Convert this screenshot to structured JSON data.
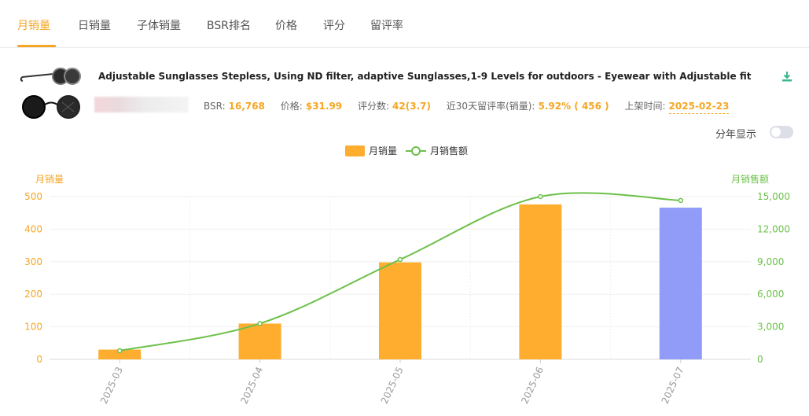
{
  "tabs": [
    {
      "label": "月销量",
      "active": true
    },
    {
      "label": "日销量"
    },
    {
      "label": "子体销量"
    },
    {
      "label": "BSR排名"
    },
    {
      "label": "价格"
    },
    {
      "label": "评分"
    },
    {
      "label": "留评率"
    }
  ],
  "product": {
    "title": "Adjustable Sunglasses Stepless, Using ND filter, adaptive Sunglasses,1-9 Levels for outdoors - Eyewear with Adjustable fit",
    "bsr_label": "BSR:",
    "bsr": "16,768",
    "price_label": "价格:",
    "price": "$31.99",
    "ratings_label": "评分数:",
    "ratings": "42(3.7)",
    "review_rate_label": "近30天留评率(销量):",
    "review_rate": "5.92% ( 456 )",
    "listed_label": "上架时间:",
    "listed_date": "2025-02-23"
  },
  "toggle": {
    "label": "分年显示",
    "on": false
  },
  "colors": {
    "accent": "#f5a623",
    "bar": "#ffad2f",
    "bar_highlight": "#909cf7",
    "line": "#6cc04a"
  },
  "icons": {
    "download": "download-icon"
  },
  "chart_data": {
    "type": "bar",
    "categories": [
      "2025-03",
      "2025-04",
      "2025-05",
      "2025-06",
      "2025-07"
    ],
    "series": [
      {
        "name": "月销量",
        "type": "bar",
        "axis": "left",
        "values": [
          30,
          110,
          298,
          476,
          466
        ]
      },
      {
        "name": "月销售额",
        "type": "line",
        "axis": "right",
        "values": [
          800,
          3300,
          9200,
          15000,
          14650
        ]
      }
    ],
    "highlighted_category": "2025-07",
    "ylabel": "月销量",
    "ylabel_right": "月销售额",
    "ylim": [
      0,
      500
    ],
    "yticks": [
      0,
      100,
      200,
      300,
      400,
      500
    ],
    "ylim_right": [
      0,
      15000
    ],
    "yticks_right": [
      "0",
      "3,000",
      "6,000",
      "9,000",
      "12,000",
      "15,000"
    ],
    "grid": true,
    "legend_position": "top-center",
    "line_smooth": true
  }
}
